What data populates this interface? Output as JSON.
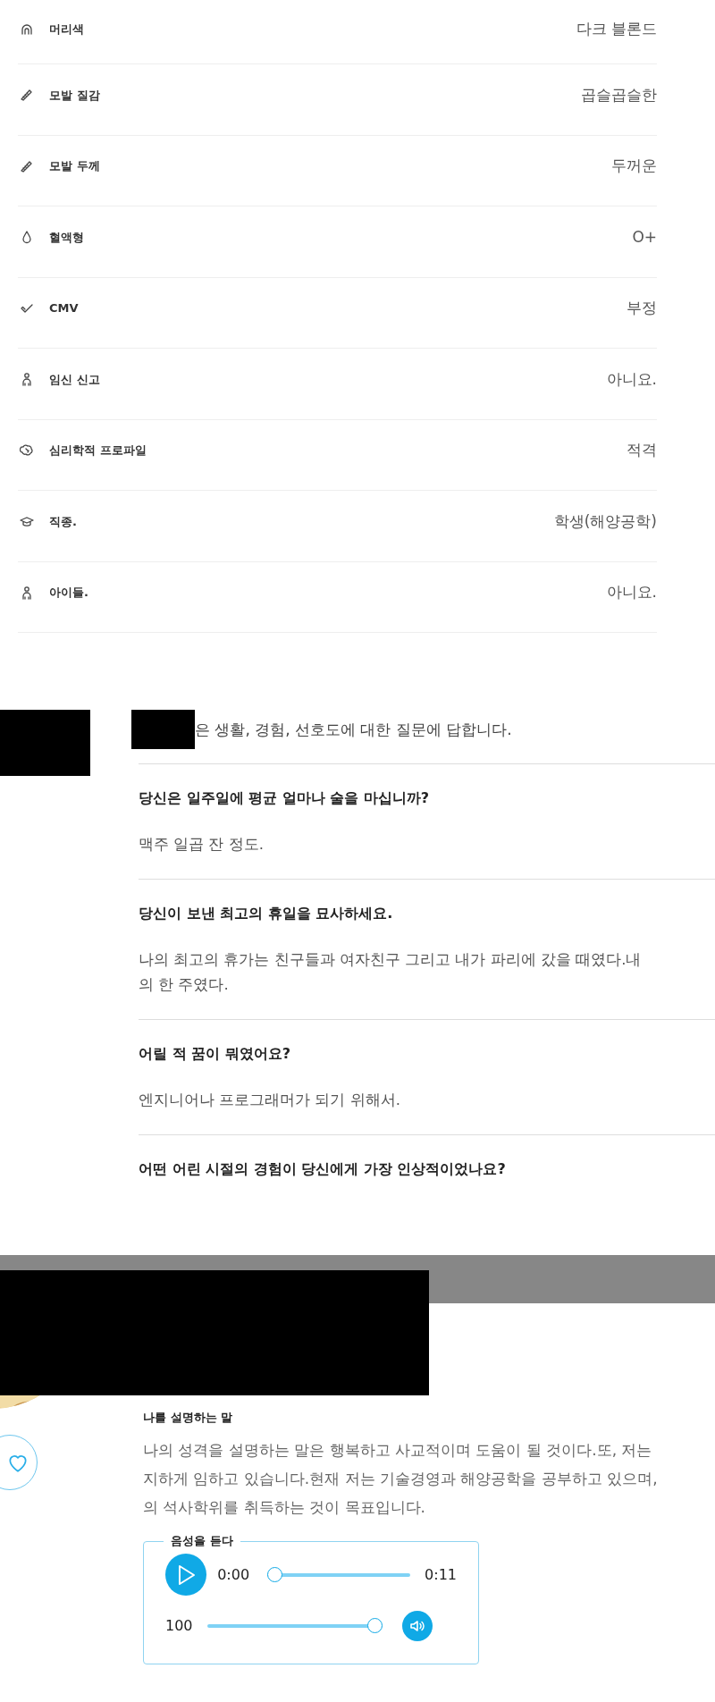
{
  "attributes": [
    {
      "label": "머리색",
      "value": "다크 블론드"
    },
    {
      "label": "모발 질감",
      "value": "곱슬곱슬한"
    },
    {
      "label": "모발 두께",
      "value": "두꺼운"
    },
    {
      "label": "혈액형",
      "value": "O+"
    },
    {
      "label": "CMV",
      "value": "부정"
    },
    {
      "label": "임신 신고",
      "value": "아니요."
    },
    {
      "label": "심리학적 프로파일",
      "value": "적격"
    },
    {
      "label": "직종.",
      "value": "학생(해양공학)"
    },
    {
      "label": "아이들.",
      "value": "아니요."
    }
  ],
  "questions_intro": "은 생활, 경험, 선호도에 대한 질문에 답합니다.",
  "questions": [
    {
      "question": "당신은 일주일에 평균 얼마나 술을 마십니까?",
      "answer_lines": [
        "맥주 일곱 잔 정도."
      ]
    },
    {
      "question": "당신이 보낸 최고의 휴일을 묘사하세요.",
      "answer_lines": [
        "나의 최고의 휴가는 친구들과 여자친구 그리고 내가 파리에 갔을 때였다.내",
        "의 한 주였다."
      ]
    },
    {
      "question": "어릴 적 꿈이 뭐였어요?",
      "answer_lines": [
        "엔지니어나 프로그래머가 되기 위해서."
      ]
    },
    {
      "question": "어떤 어린 시절의 경험이 당신에게 가장 인상적이었나요?"
    }
  ],
  "profile": {
    "bio_label": "나를 설명하는 말",
    "bio_lines": [
      "나의 성격을 설명하는 말은 행복하고 사교적이며 도움이 될 것이다.또, 저는",
      "지하게 임하고 있습니다.현재 저는 기술경영과 해양공학을 공부하고 있으며,",
      "의 석사학위를 취득하는 것이 목표입니다."
    ],
    "audio": {
      "legend": "음성을 듣다",
      "elapsed": "0:00",
      "duration": "0:11",
      "progress": {
        "level": 0
      },
      "volume": {
        "reading": "100",
        "level": 1
      }
    }
  }
}
